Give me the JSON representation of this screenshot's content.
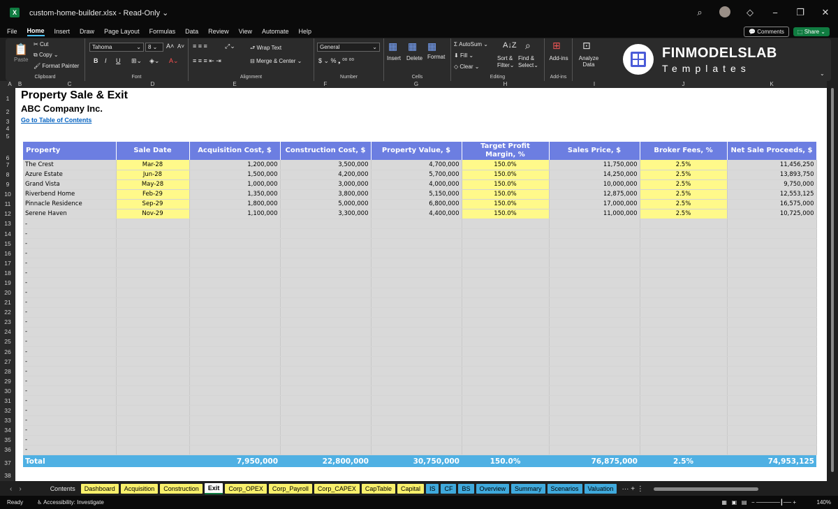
{
  "titlebar": {
    "filename": "custom-home-builder.xlsx",
    "separator": "-",
    "mode": "Read-Only",
    "icons": [
      "search-icon",
      "diamond-icon",
      "minimize-icon",
      "restore-icon",
      "close-icon"
    ]
  },
  "menus": [
    "File",
    "Home",
    "Insert",
    "Draw",
    "Page Layout",
    "Formulas",
    "Data",
    "Review",
    "View",
    "Automate",
    "Help"
  ],
  "menu_active": "Home",
  "top_right": {
    "comments": "Comments",
    "share": "Share"
  },
  "ribbon": {
    "clipboard": {
      "paste": "Paste",
      "cut": "Cut",
      "copy": "Copy",
      "format_painter": "Format Painter",
      "label": "Clipboard"
    },
    "font": {
      "name": "Tahoma",
      "size": "8",
      "bold": "B",
      "italic": "I",
      "underline": "U",
      "label": "Font"
    },
    "alignment": {
      "wrap": "Wrap Text",
      "merge": "Merge & Center",
      "label": "Alignment"
    },
    "number": {
      "format": "General",
      "label": "Number"
    },
    "cells": {
      "insert": "Insert",
      "delete": "Delete",
      "format": "Format",
      "label": "Cells"
    },
    "editing": {
      "autosum": "AutoSum",
      "fill": "Fill",
      "clear": "Clear",
      "sort": "Sort &",
      "sort2": "Filter",
      "find": "Find &",
      "find2": "Select",
      "label": "Editing"
    },
    "addins": {
      "addins": "Add-ins",
      "label": "Add-ins"
    },
    "analyze": {
      "l1": "Analyze",
      "l2": "Data"
    },
    "logo": {
      "name": "FINMODELSLAB",
      "sub": "Templates"
    }
  },
  "column_letters": [
    "A",
    "B",
    "C",
    "D",
    "E",
    "F",
    "G",
    "H",
    "I",
    "J",
    "K"
  ],
  "sheet": {
    "title": "Property Sale & Exit",
    "company": "ABC Company Inc.",
    "link": "Go to Table of Contents",
    "headers": [
      "Property",
      "Sale Date",
      "Acquisition Cost, $",
      "Construction Cost, $",
      "Property Value, $",
      "Target Profit Margin, %",
      "Sales Price, $",
      "Broker Fees, %",
      "Net Sale Proceeds, $"
    ],
    "rows": [
      [
        "The Crest",
        "Mar-28",
        "1,200,000",
        "3,500,000",
        "4,700,000",
        "150.0%",
        "11,750,000",
        "2.5%",
        "11,456,250"
      ],
      [
        "Azure Estate",
        "Jun-28",
        "1,500,000",
        "4,200,000",
        "5,700,000",
        "150.0%",
        "14,250,000",
        "2.5%",
        "13,893,750"
      ],
      [
        "Grand Vista",
        "May-28",
        "1,000,000",
        "3,000,000",
        "4,000,000",
        "150.0%",
        "10,000,000",
        "2.5%",
        "9,750,000"
      ],
      [
        "Riverbend Home",
        "Feb-29",
        "1,350,000",
        "3,800,000",
        "5,150,000",
        "150.0%",
        "12,875,000",
        "2.5%",
        "12,553,125"
      ],
      [
        "Pinnacle Residence",
        "Sep-29",
        "1,800,000",
        "5,000,000",
        "6,800,000",
        "150.0%",
        "17,000,000",
        "2.5%",
        "16,575,000"
      ],
      [
        "Serene Haven",
        "Nov-29",
        "1,100,000",
        "3,300,000",
        "4,400,000",
        "150.0%",
        "11,000,000",
        "2.5%",
        "10,725,000"
      ]
    ],
    "empty_marker": "-",
    "total": [
      "Total",
      "",
      "7,950,000",
      "22,800,000",
      "30,750,000",
      "150.0%",
      "76,875,000",
      "2.5%",
      "74,953,125"
    ]
  },
  "tabs": [
    {
      "label": "Contents",
      "style": "plain"
    },
    {
      "label": "Dashboard",
      "style": "yellow"
    },
    {
      "label": "Acquisition",
      "style": "yellow"
    },
    {
      "label": "Construction",
      "style": "yellow"
    },
    {
      "label": "Exit",
      "style": "active"
    },
    {
      "label": "Corp_OPEX",
      "style": "yellow"
    },
    {
      "label": "Corp_Payroll",
      "style": "yellow"
    },
    {
      "label": "Corp_CAPEX",
      "style": "yellow"
    },
    {
      "label": "CapTable",
      "style": "yellow"
    },
    {
      "label": "Capital",
      "style": "yellow"
    },
    {
      "label": "IS",
      "style": "blue"
    },
    {
      "label": "CF",
      "style": "blue"
    },
    {
      "label": "BS",
      "style": "blue"
    },
    {
      "label": "Overview",
      "style": "blue"
    },
    {
      "label": "Summary",
      "style": "blue"
    },
    {
      "label": "Scenarios",
      "style": "blue"
    },
    {
      "label": "Valuation",
      "style": "blue"
    }
  ],
  "status": {
    "ready": "Ready",
    "accessibility": "Accessibility: Investigate",
    "zoom": "140%"
  }
}
